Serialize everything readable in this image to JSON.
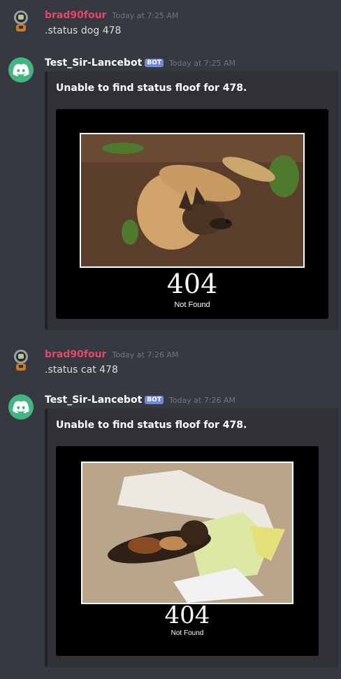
{
  "messages": [
    {
      "type": "user",
      "username": "brad90four",
      "timestamp": "Today at 7:25 AM",
      "text": ".status dog 478",
      "avatar_icon": "astronaut-avatar"
    },
    {
      "type": "bot",
      "username": "Test_Sir-Lancebot",
      "bot_tag": "BOT",
      "timestamp": "Today at 7:25 AM",
      "avatar_icon": "discord-logo-icon",
      "embed": {
        "title": "Unable to find status floof for 478.",
        "image_code": "404",
        "image_text": "Not Found",
        "image_subject": "dog"
      }
    },
    {
      "type": "user",
      "username": "brad90four",
      "timestamp": "Today at 7:26 AM",
      "text": ".status cat 478",
      "avatar_icon": "astronaut-avatar"
    },
    {
      "type": "bot",
      "username": "Test_Sir-Lancebot",
      "bot_tag": "BOT",
      "timestamp": "Today at 7:26 AM",
      "avatar_icon": "discord-logo-icon",
      "embed": {
        "title": "Unable to find status floof for 478.",
        "image_code": "404",
        "image_text": "Not Found",
        "image_subject": "cat"
      }
    }
  ],
  "colors": {
    "background": "#36393f",
    "embed_bg": "#2f3136",
    "user_name": "#e9456a",
    "bot_avatar": "#43b581",
    "bot_tag": "#7289da"
  }
}
